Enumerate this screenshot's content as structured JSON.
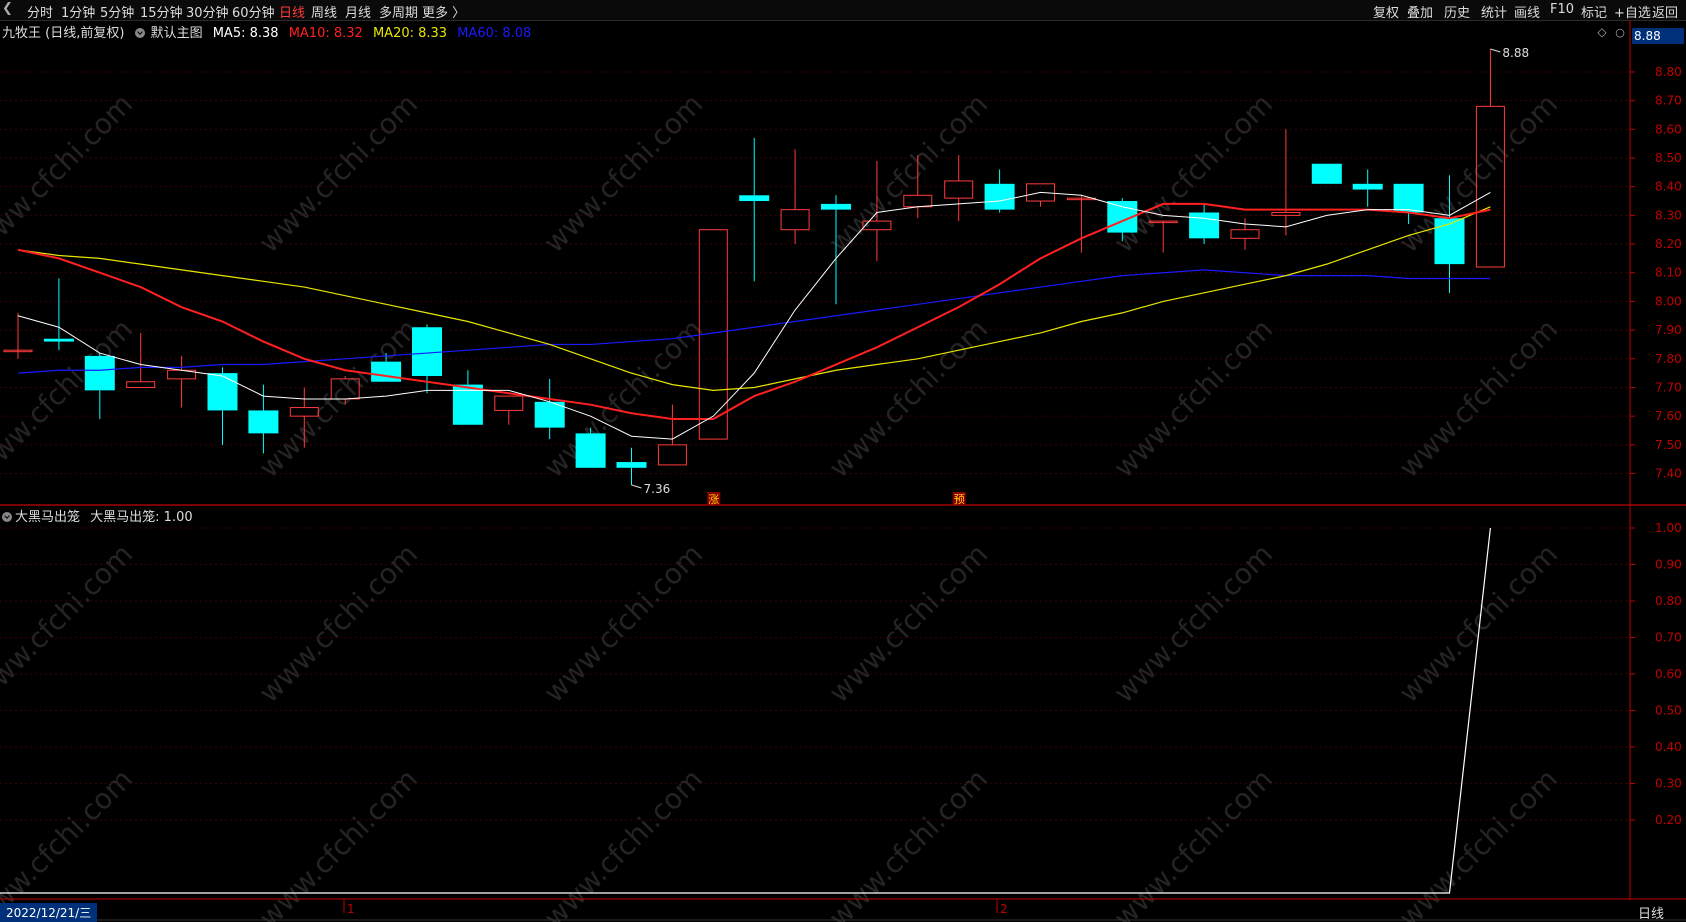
{
  "toolbar": {
    "periods": [
      "分时",
      "1分钟",
      "5分钟",
      "15分钟",
      "30分钟",
      "60分钟",
      "日线",
      "周线",
      "月线",
      "多周期",
      "更多 〉"
    ],
    "active_period": "日线",
    "right_items": [
      "复权",
      "叠加",
      "历史",
      "统计",
      "画线",
      "F10",
      "标记",
      "+自选",
      "返回"
    ]
  },
  "main_legend": {
    "title": "九牧王 (日线,前复权)",
    "indicator": "默认主图",
    "ma5": "MA5: 8.38",
    "ma10": "MA10: 8.32",
    "ma20": "MA20: 8.33",
    "ma60": "MA60: 8.08"
  },
  "sub_legend": {
    "title": "大黑马出笼",
    "value": "大黑马出笼: 1.00"
  },
  "current_price_tag": "8.88",
  "high_label": "8.88",
  "low_label": "7.36",
  "markers": [
    "涨",
    "预"
  ],
  "date_label": "2022/12/21/三",
  "month_labels": [
    "1",
    "2"
  ],
  "period_footer": "日线",
  "watermark": "www.cfchi.com",
  "colors": {
    "up": "#ff3b3b",
    "down": "#00ffff",
    "ma5": "#ffffff",
    "ma10": "#ff2020",
    "ma20": "#e6e600",
    "ma60": "#1a1aff",
    "axis": "#c00000"
  },
  "chart_data": [
    {
      "type": "candlestick",
      "title": "九牧王 (日线,前复权)",
      "ylim": [
        7.28,
        8.98
      ],
      "yticks": [
        "8.80",
        "8.70",
        "8.60",
        "8.50",
        "8.40",
        "8.30",
        "8.20",
        "8.10",
        "8.00",
        "7.90",
        "7.80",
        "7.70",
        "7.60",
        "7.50",
        "7.40"
      ],
      "candles": [
        {
          "o": 7.83,
          "h": 7.96,
          "l": 7.8,
          "c": 7.83
        },
        {
          "o": 7.87,
          "h": 8.08,
          "l": 7.83,
          "c": 7.86
        },
        {
          "o": 7.81,
          "h": 7.82,
          "l": 7.59,
          "c": 7.69
        },
        {
          "o": 7.7,
          "h": 7.89,
          "l": 7.7,
          "c": 7.72
        },
        {
          "o": 7.73,
          "h": 7.81,
          "l": 7.63,
          "c": 7.76
        },
        {
          "o": 7.75,
          "h": 7.77,
          "l": 7.5,
          "c": 7.62
        },
        {
          "o": 7.62,
          "h": 7.71,
          "l": 7.47,
          "c": 7.54
        },
        {
          "o": 7.6,
          "h": 7.7,
          "l": 7.49,
          "c": 7.63
        },
        {
          "o": 7.66,
          "h": 7.74,
          "l": 7.64,
          "c": 7.73
        },
        {
          "o": 7.79,
          "h": 7.82,
          "l": 7.72,
          "c": 7.72
        },
        {
          "o": 7.91,
          "h": 7.92,
          "l": 7.68,
          "c": 7.74
        },
        {
          "o": 7.71,
          "h": 7.76,
          "l": 7.57,
          "c": 7.57
        },
        {
          "o": 7.62,
          "h": 7.67,
          "l": 7.57,
          "c": 7.67
        },
        {
          "o": 7.65,
          "h": 7.73,
          "l": 7.52,
          "c": 7.56
        },
        {
          "o": 7.54,
          "h": 7.56,
          "l": 7.42,
          "c": 7.42
        },
        {
          "o": 7.44,
          "h": 7.49,
          "l": 7.36,
          "c": 7.42
        },
        {
          "o": 7.43,
          "h": 7.64,
          "l": 7.43,
          "c": 7.5
        },
        {
          "o": 7.52,
          "h": 8.25,
          "l": 7.52,
          "c": 8.25
        },
        {
          "o": 8.37,
          "h": 8.57,
          "l": 8.07,
          "c": 8.35
        },
        {
          "o": 8.25,
          "h": 8.53,
          "l": 8.2,
          "c": 8.32
        },
        {
          "o": 8.34,
          "h": 8.37,
          "l": 7.99,
          "c": 8.32
        },
        {
          "o": 8.25,
          "h": 8.49,
          "l": 8.14,
          "c": 8.28
        },
        {
          "o": 8.33,
          "h": 8.51,
          "l": 8.29,
          "c": 8.37
        },
        {
          "o": 8.36,
          "h": 8.51,
          "l": 8.28,
          "c": 8.42
        },
        {
          "o": 8.41,
          "h": 8.46,
          "l": 8.31,
          "c": 8.32
        },
        {
          "o": 8.35,
          "h": 8.41,
          "l": 8.33,
          "c": 8.41
        },
        {
          "o": 8.36,
          "h": 8.37,
          "l": 8.17,
          "c": 8.36
        },
        {
          "o": 8.35,
          "h": 8.36,
          "l": 8.21,
          "c": 8.24
        },
        {
          "o": 8.28,
          "h": 8.28,
          "l": 8.17,
          "c": 8.28
        },
        {
          "o": 8.31,
          "h": 8.34,
          "l": 8.2,
          "c": 8.22
        },
        {
          "o": 8.22,
          "h": 8.29,
          "l": 8.18,
          "c": 8.25
        },
        {
          "o": 8.3,
          "h": 8.6,
          "l": 8.23,
          "c": 8.31
        },
        {
          "o": 8.48,
          "h": 8.48,
          "l": 8.41,
          "c": 8.41
        },
        {
          "o": 8.41,
          "h": 8.46,
          "l": 8.33,
          "c": 8.39
        },
        {
          "o": 8.41,
          "h": 8.41,
          "l": 8.27,
          "c": 8.31
        },
        {
          "o": 8.29,
          "h": 8.44,
          "l": 8.03,
          "c": 8.13
        },
        {
          "o": 8.12,
          "h": 8.88,
          "l": 8.12,
          "c": 8.68
        }
      ],
      "ma5": [
        7.95,
        7.91,
        7.82,
        7.78,
        7.76,
        7.74,
        7.67,
        7.66,
        7.66,
        7.67,
        7.69,
        7.69,
        7.69,
        7.65,
        7.6,
        7.53,
        7.52,
        7.6,
        7.75,
        7.97,
        8.15,
        8.31,
        8.33,
        8.34,
        8.35,
        8.38,
        8.37,
        8.33,
        8.3,
        8.29,
        8.27,
        8.26,
        8.3,
        8.32,
        8.32,
        8.3,
        8.38
      ],
      "ma10": [
        8.18,
        8.15,
        8.1,
        8.05,
        7.98,
        7.93,
        7.86,
        7.8,
        7.76,
        7.74,
        7.72,
        7.7,
        7.68,
        7.66,
        7.64,
        7.61,
        7.59,
        7.59,
        7.67,
        7.72,
        7.78,
        7.84,
        7.91,
        7.98,
        8.06,
        8.15,
        8.22,
        8.28,
        8.34,
        8.34,
        8.32,
        8.32,
        8.32,
        8.32,
        8.31,
        8.29,
        8.32
      ],
      "ma20": [
        8.18,
        8.16,
        8.15,
        8.13,
        8.11,
        8.09,
        8.07,
        8.05,
        8.02,
        7.99,
        7.96,
        7.93,
        7.89,
        7.85,
        7.8,
        7.75,
        7.71,
        7.69,
        7.7,
        7.73,
        7.76,
        7.78,
        7.8,
        7.83,
        7.86,
        7.89,
        7.93,
        7.96,
        8.0,
        8.03,
        8.06,
        8.09,
        8.13,
        8.18,
        8.23,
        8.27,
        8.33
      ],
      "ma60": [
        7.75,
        7.76,
        7.76,
        7.77,
        7.77,
        7.78,
        7.78,
        7.79,
        7.8,
        7.81,
        7.82,
        7.83,
        7.84,
        7.85,
        7.85,
        7.86,
        7.87,
        7.89,
        7.91,
        7.93,
        7.95,
        7.97,
        7.99,
        8.01,
        8.03,
        8.05,
        8.07,
        8.09,
        8.1,
        8.11,
        8.1,
        8.09,
        8.09,
        8.09,
        8.08,
        8.08,
        8.08
      ]
    },
    {
      "type": "line",
      "title": "大黑马出笼",
      "ylim": [
        0,
        1.05
      ],
      "yticks": [
        "1.00",
        "0.90",
        "0.80",
        "0.70",
        "0.60",
        "0.50",
        "0.40",
        "0.30",
        "0.20"
      ],
      "values": [
        0,
        0,
        0,
        0,
        0,
        0,
        0,
        0,
        0,
        0,
        0,
        0,
        0,
        0,
        0,
        0,
        0,
        0,
        0,
        0,
        0,
        0,
        0,
        0,
        0,
        0,
        0,
        0,
        0,
        0,
        0,
        0,
        0,
        0,
        0,
        0,
        1
      ]
    }
  ]
}
